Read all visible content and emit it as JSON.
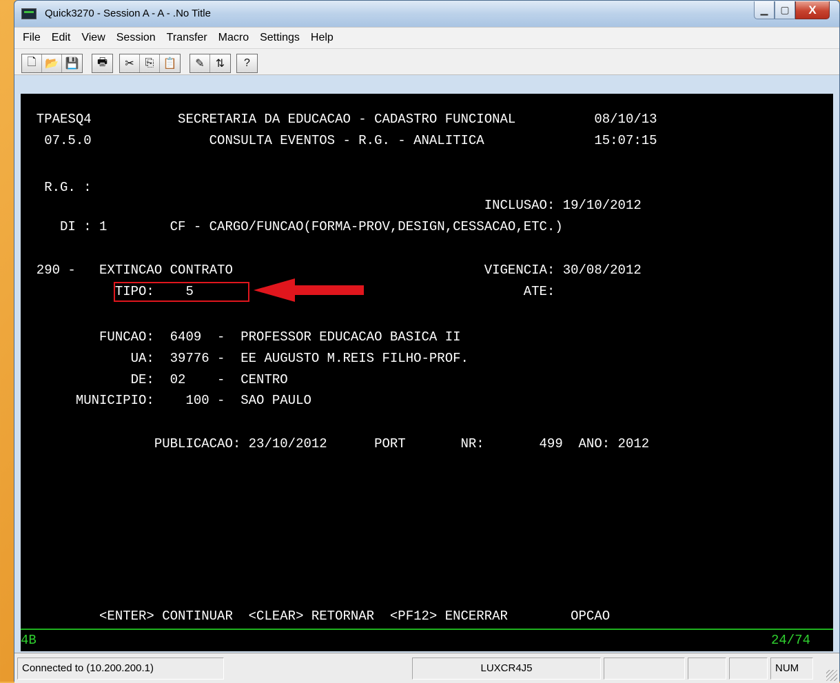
{
  "window": {
    "title": "Quick3270 - Session A - A - .No Title",
    "controls": {
      "minimize": "▁",
      "maximize": "▢",
      "close": "X"
    }
  },
  "menu": [
    "File",
    "Edit",
    "View",
    "Session",
    "Transfer",
    "Macro",
    "Settings",
    "Help"
  ],
  "toolbar": {
    "groups": [
      [
        "new-icon",
        "open-icon",
        "save-icon"
      ],
      [
        "print-icon"
      ],
      [
        "cut-icon",
        "copy-icon",
        "paste-icon"
      ],
      [
        "edit-icon",
        "transfer-icon"
      ],
      [
        "help-icon"
      ]
    ],
    "glyphs": {
      "new-icon": "🗋",
      "open-icon": "📂",
      "save-icon": "💾",
      "print-icon": "🖶",
      "cut-icon": "✂",
      "copy-icon": "⎘",
      "paste-icon": "📋",
      "edit-icon": "✎",
      "transfer-icon": "⇅",
      "help-icon": "?"
    }
  },
  "terminal": {
    "text_color": "#ffffff",
    "status_color": "#2fd12f",
    "highlight_color": "#e0161d",
    "lines": {
      "l1": "  TPAESQ4           SECRETARIA DA EDUCACAO - CADASTRO FUNCIONAL          08/10/13",
      "l2": "   07.5.0               CONSULTA EVENTOS - R.G. - ANALITICA              15:07:15",
      "l3": "   R.G. :",
      "l4": "                                                           INCLUSAO: 19/10/2012",
      "l5": "     DI : 1        CF - CARGO/FUNCAO(FORMA-PROV,DESIGN,CESSACAO,ETC.)",
      "l6": "  290 -   EXTINCAO CONTRATO                                VIGENCIA: 30/08/2012",
      "l7": "            TIPO:    5                                          ATE:",
      "l8": "          FUNCAO:  6409  -  PROFESSOR EDUCACAO BASICA II",
      "l9": "              UA:  39776 -  EE AUGUSTO M.REIS FILHO-PROF.",
      "l10": "              DE:  02    -  CENTRO",
      "l11": "       MUNICIPIO:    100 -  SAO PAULO",
      "l12": "                 PUBLICACAO: 23/10/2012      PORT       NR:       499  ANO: 2012",
      "l13": "          <ENTER> CONTINUAR  <CLEAR> RETORNAR  <PF12> ENCERRAR        OPCAO"
    },
    "oia_left": "4B",
    "oia_right": "24/74"
  },
  "statusbar": {
    "connection": "Connected to  (10.200.200.1)",
    "lu_name": "LUXCR4J5",
    "num": "NUM"
  }
}
